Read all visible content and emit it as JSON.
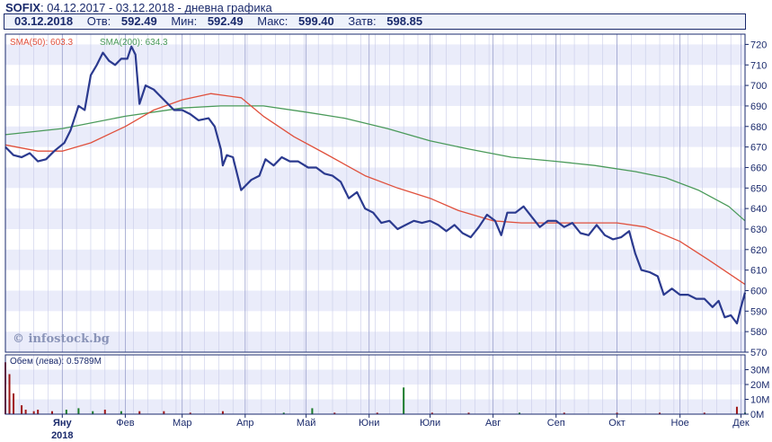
{
  "header": {
    "symbol": "SOFIX",
    "colon": ":",
    "range": "04.12.2017 - 03.12.2018 - дневна графика"
  },
  "info": {
    "date": "03.12.2018",
    "open_label": "Отв:",
    "open": "592.49",
    "low_label": "Мин:",
    "low": "592.49",
    "high_label": "Макс:",
    "high": "599.40",
    "close_label": "Затв:",
    "close": "598.85"
  },
  "watermark": "© infostock.bg",
  "colors": {
    "price": "#2b3a8f",
    "sma50": "#e0503c",
    "sma200": "#4a9a5a",
    "volume_down": "#a01818",
    "volume_up": "#1a7a2a",
    "band": "#eaecfa",
    "grid": "#c8cce8"
  },
  "chart_data": [
    {
      "type": "line",
      "legend": [
        {
          "name": "SMA(50)",
          "value": "603.3"
        },
        {
          "name": "SMA(200)",
          "value": "634.3"
        }
      ],
      "ylim": [
        570,
        725
      ],
      "y_ticks": [
        570,
        580,
        590,
        600,
        610,
        620,
        630,
        640,
        650,
        660,
        670,
        680,
        690,
        700,
        710,
        720
      ],
      "x_tick_labels": [
        "Яну",
        "Фев",
        "Мар",
        "Апр",
        "Май",
        "Юни",
        "Юли",
        "Авг",
        "Сеп",
        "Окт",
        "Ное",
        "Дек"
      ],
      "x_year_label": "2018",
      "x_range": [
        "2017-12-04",
        "2018-12-03"
      ],
      "series": [
        {
          "name": "SOFIX",
          "points": [
            [
              "2017-12-04",
              670
            ],
            [
              "2017-12-08",
              666
            ],
            [
              "2017-12-12",
              665
            ],
            [
              "2017-12-16",
              667
            ],
            [
              "2017-12-20",
              663
            ],
            [
              "2017-12-24",
              664
            ],
            [
              "2017-12-28",
              668
            ],
            [
              "2018-01-02",
              672
            ],
            [
              "2018-01-05",
              678
            ],
            [
              "2018-01-09",
              690
            ],
            [
              "2018-01-12",
              688
            ],
            [
              "2018-01-15",
              705
            ],
            [
              "2018-01-18",
              710
            ],
            [
              "2018-01-21",
              716
            ],
            [
              "2018-01-24",
              712
            ],
            [
              "2018-01-27",
              710
            ],
            [
              "2018-01-30",
              713
            ],
            [
              "2018-02-02",
              713
            ],
            [
              "2018-02-04",
              719
            ],
            [
              "2018-02-06",
              715
            ],
            [
              "2018-02-08",
              691
            ],
            [
              "2018-02-11",
              700
            ],
            [
              "2018-02-15",
              698
            ],
            [
              "2018-02-18",
              695
            ],
            [
              "2018-02-22",
              691
            ],
            [
              "2018-02-25",
              688
            ],
            [
              "2018-03-01",
              688
            ],
            [
              "2018-03-05",
              686
            ],
            [
              "2018-03-09",
              683
            ],
            [
              "2018-03-14",
              684
            ],
            [
              "2018-03-17",
              680
            ],
            [
              "2018-03-20",
              669
            ],
            [
              "2018-03-21",
              661
            ],
            [
              "2018-03-23",
              666
            ],
            [
              "2018-03-26",
              665
            ],
            [
              "2018-03-30",
              649
            ],
            [
              "2018-04-04",
              654
            ],
            [
              "2018-04-08",
              656
            ],
            [
              "2018-04-11",
              664
            ],
            [
              "2018-04-15",
              661
            ],
            [
              "2018-04-19",
              665
            ],
            [
              "2018-04-23",
              663
            ],
            [
              "2018-04-27",
              663
            ],
            [
              "2018-05-02",
              660
            ],
            [
              "2018-05-06",
              660
            ],
            [
              "2018-05-10",
              657
            ],
            [
              "2018-05-14",
              656
            ],
            [
              "2018-05-18",
              653
            ],
            [
              "2018-05-22",
              645
            ],
            [
              "2018-05-26",
              648
            ],
            [
              "2018-05-30",
              640
            ],
            [
              "2018-06-03",
              638
            ],
            [
              "2018-06-07",
              633
            ],
            [
              "2018-06-11",
              634
            ],
            [
              "2018-06-15",
              630
            ],
            [
              "2018-06-19",
              632
            ],
            [
              "2018-06-23",
              634
            ],
            [
              "2018-06-27",
              633
            ],
            [
              "2018-07-01",
              634
            ],
            [
              "2018-07-05",
              632
            ],
            [
              "2018-07-09",
              629
            ],
            [
              "2018-07-13",
              632
            ],
            [
              "2018-07-17",
              628
            ],
            [
              "2018-07-21",
              626
            ],
            [
              "2018-07-25",
              631
            ],
            [
              "2018-07-29",
              637
            ],
            [
              "2018-08-02",
              634
            ],
            [
              "2018-08-05",
              627
            ],
            [
              "2018-08-08",
              638
            ],
            [
              "2018-08-12",
              638
            ],
            [
              "2018-08-16",
              641
            ],
            [
              "2018-08-20",
              636
            ],
            [
              "2018-08-24",
              631
            ],
            [
              "2018-08-28",
              634
            ],
            [
              "2018-09-01",
              634
            ],
            [
              "2018-09-05",
              631
            ],
            [
              "2018-09-09",
              633
            ],
            [
              "2018-09-13",
              628
            ],
            [
              "2018-09-17",
              627
            ],
            [
              "2018-09-21",
              632
            ],
            [
              "2018-09-25",
              627
            ],
            [
              "2018-09-29",
              625
            ],
            [
              "2018-10-03",
              626
            ],
            [
              "2018-10-07",
              629
            ],
            [
              "2018-10-10",
              618
            ],
            [
              "2018-10-13",
              610
            ],
            [
              "2018-10-17",
              609
            ],
            [
              "2018-10-21",
              607
            ],
            [
              "2018-10-24",
              598
            ],
            [
              "2018-10-28",
              601
            ],
            [
              "2018-11-01",
              598
            ],
            [
              "2018-11-05",
              598
            ],
            [
              "2018-11-09",
              596
            ],
            [
              "2018-11-13",
              596
            ],
            [
              "2018-11-17",
              592
            ],
            [
              "2018-11-20",
              595
            ],
            [
              "2018-11-23",
              587
            ],
            [
              "2018-11-26",
              588
            ],
            [
              "2018-11-29",
              584
            ],
            [
              "2018-12-01",
              592
            ],
            [
              "2018-12-03",
              599
            ]
          ]
        },
        {
          "name": "SMA(50)",
          "points": [
            [
              "2017-12-04",
              671
            ],
            [
              "2017-12-20",
              668
            ],
            [
              "2018-01-01",
              668
            ],
            [
              "2018-01-15",
              672
            ],
            [
              "2018-02-01",
              680
            ],
            [
              "2018-02-15",
              688
            ],
            [
              "2018-03-01",
              693
            ],
            [
              "2018-03-15",
              696
            ],
            [
              "2018-03-30",
              694
            ],
            [
              "2018-04-10",
              685
            ],
            [
              "2018-04-25",
              675
            ],
            [
              "2018-05-10",
              667
            ],
            [
              "2018-05-30",
              656
            ],
            [
              "2018-06-15",
              650
            ],
            [
              "2018-07-01",
              645
            ],
            [
              "2018-07-15",
              639
            ],
            [
              "2018-08-01",
              634
            ],
            [
              "2018-08-15",
              633
            ],
            [
              "2018-09-01",
              633
            ],
            [
              "2018-09-15",
              633
            ],
            [
              "2018-10-01",
              633
            ],
            [
              "2018-10-15",
              631
            ],
            [
              "2018-11-01",
              624
            ],
            [
              "2018-11-15",
              615
            ],
            [
              "2018-12-03",
              603
            ]
          ]
        },
        {
          "name": "SMA(200)",
          "points": [
            [
              "2017-12-04",
              676
            ],
            [
              "2018-01-01",
              679
            ],
            [
              "2018-02-01",
              685
            ],
            [
              "2018-03-01",
              689
            ],
            [
              "2018-03-20",
              690
            ],
            [
              "2018-04-10",
              690
            ],
            [
              "2018-05-01",
              687
            ],
            [
              "2018-05-20",
              684
            ],
            [
              "2018-06-10",
              679
            ],
            [
              "2018-07-01",
              673
            ],
            [
              "2018-07-20",
              669
            ],
            [
              "2018-08-10",
              665
            ],
            [
              "2018-09-01",
              663
            ],
            [
              "2018-09-20",
              661
            ],
            [
              "2018-10-10",
              658
            ],
            [
              "2018-10-25",
              655
            ],
            [
              "2018-11-10",
              649
            ],
            [
              "2018-11-25",
              641
            ],
            [
              "2018-12-03",
              634
            ]
          ]
        }
      ]
    },
    {
      "type": "bar",
      "legend": [
        {
          "name": "Обем (лева)",
          "value": "0.5789M"
        }
      ],
      "ylim": [
        0,
        40
      ],
      "y_ticks": [
        "0M",
        "10M",
        "20M",
        "30M"
      ],
      "bars": [
        {
          "date": "2017-12-04",
          "value": 35,
          "dir": "down"
        },
        {
          "date": "2017-12-06",
          "value": 27,
          "dir": "down"
        },
        {
          "date": "2017-12-08",
          "value": 14,
          "dir": "down"
        },
        {
          "date": "2017-12-12",
          "value": 6,
          "dir": "down"
        },
        {
          "date": "2017-12-14",
          "value": 3,
          "dir": "down"
        },
        {
          "date": "2017-12-18",
          "value": 2,
          "dir": "down"
        },
        {
          "date": "2017-12-20",
          "value": 3,
          "dir": "down"
        },
        {
          "date": "2017-12-27",
          "value": 2,
          "dir": "down"
        },
        {
          "date": "2018-01-03",
          "value": 3,
          "dir": "up"
        },
        {
          "date": "2018-01-09",
          "value": 4,
          "dir": "up"
        },
        {
          "date": "2018-01-16",
          "value": 2,
          "dir": "up"
        },
        {
          "date": "2018-01-22",
          "value": 3,
          "dir": "down"
        },
        {
          "date": "2018-01-30",
          "value": 2,
          "dir": "up"
        },
        {
          "date": "2018-02-08",
          "value": 2,
          "dir": "down"
        },
        {
          "date": "2018-02-20",
          "value": 2,
          "dir": "down"
        },
        {
          "date": "2018-03-05",
          "value": 1,
          "dir": "down"
        },
        {
          "date": "2018-03-21",
          "value": 2,
          "dir": "down"
        },
        {
          "date": "2018-04-20",
          "value": 1,
          "dir": "up"
        },
        {
          "date": "2018-05-04",
          "value": 4,
          "dir": "up"
        },
        {
          "date": "2018-05-15",
          "value": 1,
          "dir": "down"
        },
        {
          "date": "2018-06-05",
          "value": 1,
          "dir": "down"
        },
        {
          "date": "2018-06-18",
          "value": 18,
          "dir": "up"
        },
        {
          "date": "2018-07-02",
          "value": 1,
          "dir": "down"
        },
        {
          "date": "2018-07-20",
          "value": 1,
          "dir": "down"
        },
        {
          "date": "2018-08-14",
          "value": 1,
          "dir": "up"
        },
        {
          "date": "2018-09-05",
          "value": 1,
          "dir": "down"
        },
        {
          "date": "2018-10-01",
          "value": 1,
          "dir": "down"
        },
        {
          "date": "2018-10-22",
          "value": 1,
          "dir": "down"
        },
        {
          "date": "2018-11-13",
          "value": 1,
          "dir": "down"
        },
        {
          "date": "2018-11-29",
          "value": 5,
          "dir": "down"
        },
        {
          "date": "2018-12-03",
          "value": 1,
          "dir": "up"
        }
      ]
    }
  ]
}
